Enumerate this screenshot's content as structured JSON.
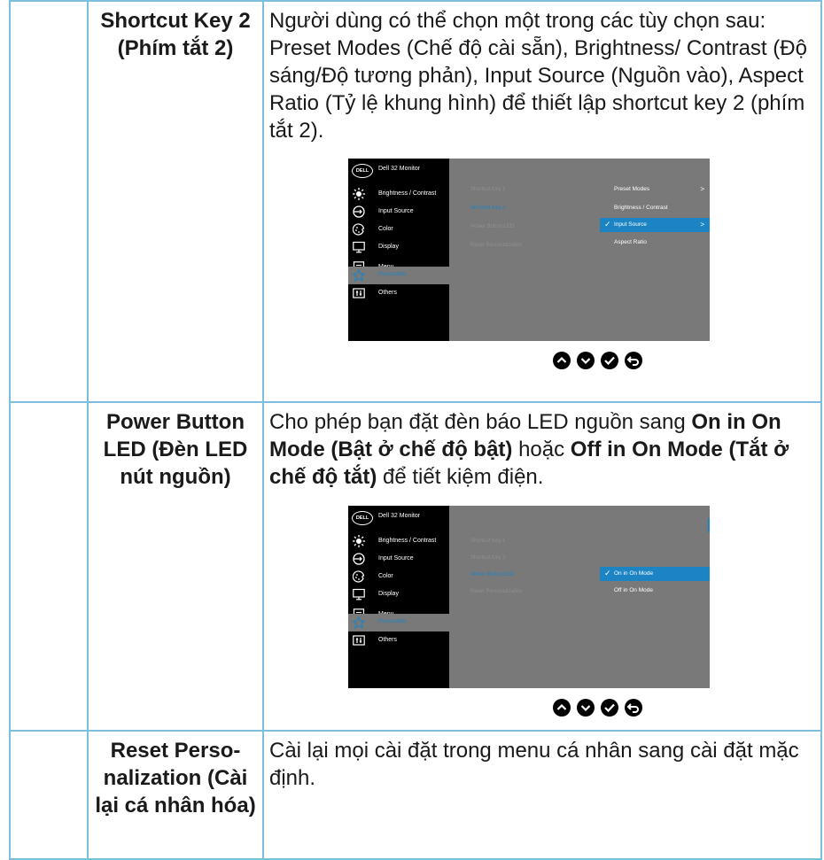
{
  "rows": [
    {
      "param": "Shortcut Key 2 (Phím tắt 2)",
      "desc": "Người dùng có thể chọn một trong các tùy chọn sau: Preset Modes (Chế độ cài sẵn), Brightness/ Contrast (Độ sáng/Độ tương phản), Input Source (Nguồn vào), Aspect Ratio (Tỷ lệ khung hình) để thiết lập shortcut key 2 (phím tắt 2)."
    },
    {
      "param": "Power Button LED (Đèn LED nút nguồn)",
      "desc_parts": {
        "a": "Cho phép bạn đặt đèn báo LED nguồn sang ",
        "b": "On in On Mode (Bật ở chế độ bật)",
        "c": " hoặc ",
        "d": "Off in On Mode (Tắt ở chế độ tắt)",
        "e": " để tiết kiệm điện."
      }
    },
    {
      "param": "Reset Perso-nalization (Cài lại cá nhân hóa)",
      "desc": "Cài lại mọi cài đặt trong menu cá nhân sang cài đặt mặc định."
    }
  ],
  "osd": {
    "logo": "DELL",
    "model": "Dell 32 Monitor",
    "menu": [
      "Brightness / Contrast",
      "Input Source",
      "Color",
      "Display",
      "Menu",
      "Personalize",
      "Others"
    ],
    "menu_icons": [
      "brightness-icon",
      "input-source-icon",
      "color-icon",
      "display-icon",
      "menu-icon",
      "personalize-star-icon",
      "others-icon"
    ],
    "submenu": [
      "Shortcut Key 1",
      "Shortcut Key 2",
      "Power Button LED",
      "Reset Personalization"
    ],
    "shot1_options": [
      "Preset Modes",
      "Brightness / Contrast",
      "Input Source",
      "Aspect Ratio"
    ],
    "shot2_options": [
      "On in On Mode",
      "Off in On Mode"
    ],
    "check": "✓",
    "arrow": ">",
    "accent": "#1d84c4",
    "nav_icons": [
      "up-icon",
      "down-icon",
      "check-icon",
      "back-icon"
    ]
  }
}
